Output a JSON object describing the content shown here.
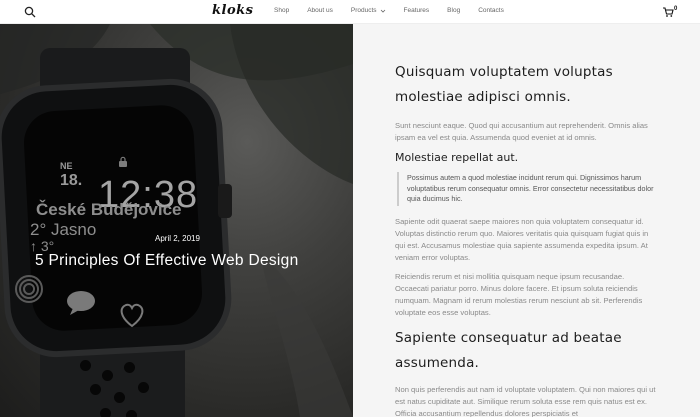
{
  "header": {
    "logo": "kloks",
    "nav": [
      "Shop",
      "About us",
      "Products",
      "Features",
      "Blog",
      "Contacts"
    ],
    "cart_count": "0"
  },
  "hero": {
    "watch": {
      "day": "NE",
      "date": "18.",
      "time": "12:38",
      "city": "České Budějovice",
      "weather": "2° Jasno",
      "arrow": "↑ 3°"
    },
    "post_date": "April 2, 2019",
    "post_title": "5 Principles Of Effective Web Design"
  },
  "article": {
    "heading1": "Quisquam voluptatem voluptas molestiae adipisci omnis.",
    "p1": "Sunt nesciunt eaque. Quod qui accusantium aut reprehenderit. Omnis alias ipsam ea vel est quia. Assumenda quod eveniet at id omnis.",
    "heading2": "Molestiae repellat aut.",
    "quote": "Possimus autem a quod molestiae incidunt rerum qui. Dignissimos harum voluptatibus rerum consequatur omnis. Error consectetur necessitatibus dolor quia ducimus hic.",
    "p2": "Sapiente odit quaerat saepe maiores non quia voluptatem consequatur id. Voluptas distinctio rerum quo. Maiores veritatis quia quisquam fugiat quis in qui est. Accusamus molestiae quia sapiente assumenda expedita ipsum. At veniam error voluptas.",
    "p3": "Reiciendis rerum et nisi mollitia quisquam neque ipsum recusandae. Occaecati pariatur porro. Minus dolore facere. Et ipsum soluta reiciendis numquam. Magnam id rerum molestias rerum nesciunt ab sit. Perferendis voluptate eos esse voluptas.",
    "heading3": "Sapiente consequatur ad beatae assumenda.",
    "p4": "Non quis perferendis aut nam id voluptate voluptatem. Qui non maiores qui ut est natus cupiditate aut. Similique rerum soluta esse rem quis natus est ex. Officia accusantium repellendus dolores perspiciatis et"
  }
}
